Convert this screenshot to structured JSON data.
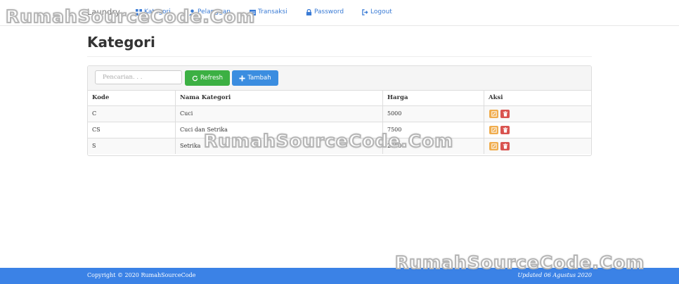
{
  "watermark": "RumahSourceCode.Com",
  "navbar": {
    "brand": "Laundry",
    "items": [
      {
        "label": "Kategori",
        "icon": "grid-icon"
      },
      {
        "label": "Pelanggan",
        "icon": "user-icon"
      },
      {
        "label": "Transaksi",
        "icon": "calendar-icon"
      },
      {
        "label": "Password",
        "icon": "lock-icon"
      },
      {
        "label": "Logout",
        "icon": "logout-icon"
      }
    ]
  },
  "page": {
    "title": "Kategori"
  },
  "toolbar": {
    "search_placeholder": "Pencarian. . .",
    "refresh_label": "Refresh",
    "add_label": "Tambah"
  },
  "table": {
    "headers": [
      "Kode",
      "Nama Kategori",
      "Harga",
      "Aksi"
    ],
    "rows": [
      {
        "kode": "C",
        "nama": "Cuci",
        "harga": "5000"
      },
      {
        "kode": "CS",
        "nama": "Cuci dan Setrika",
        "harga": "7500"
      },
      {
        "kode": "S",
        "nama": "Setrika",
        "harga": "2500"
      }
    ]
  },
  "footer": {
    "copyright": "Copyright © 2020 RumahSourceCode",
    "updated": "Updated 06 Agustus 2020"
  },
  "colors": {
    "primary": "#3b8de0",
    "success": "#3cb043",
    "warning": "#f0ad4e",
    "danger": "#d9534f",
    "footer": "#3b82e6"
  }
}
